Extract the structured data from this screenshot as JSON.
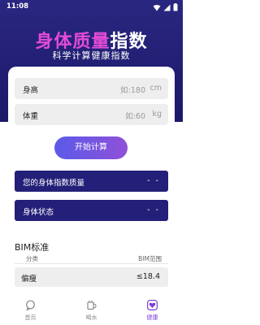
{
  "status": {
    "time": "11:08"
  },
  "header": {
    "title_part1": "身体质量",
    "title_part2": "指数",
    "subtitle": "科学计算健康指数"
  },
  "form": {
    "height": {
      "label": "身高",
      "placeholder": "如:180",
      "unit": "cm"
    },
    "weight": {
      "label": "体重",
      "placeholder": "如:60",
      "unit": "kg"
    },
    "calc_button": "开始计算"
  },
  "results": {
    "bmi_label": "您的身体指数质量",
    "bmi_value": "- -",
    "state_label": "身体状态",
    "state_value": "- -"
  },
  "standard": {
    "title": "BIM标准",
    "col_category": "分类",
    "col_range": "BIM范围",
    "rows": [
      {
        "category": "偏瘦",
        "range": "≤18.4"
      }
    ]
  },
  "tabs": [
    {
      "label": "首页",
      "icon": "chat-bubble-icon",
      "active": false
    },
    {
      "label": "喝水",
      "icon": "cup-icon",
      "active": false
    },
    {
      "label": "健康",
      "icon": "heart-icon",
      "active": true
    }
  ],
  "colors": {
    "header_bg": "#221f78",
    "title_highlight": "#e34bd7",
    "result_bg": "#241f78",
    "active_tab": "#7b3fd6"
  }
}
